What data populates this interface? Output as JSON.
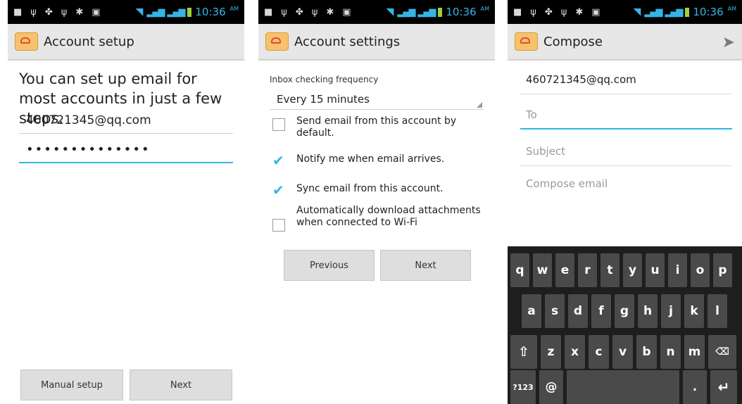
{
  "status": {
    "time": "10:36",
    "ampm": "AM",
    "icons": [
      "notification-icon",
      "usb-icon",
      "usb-debug-icon",
      "usb-icon",
      "bluetooth-icon",
      "gallery-icon"
    ]
  },
  "screen1": {
    "title": "Account setup",
    "heading": "You can set up email for most accounts in just a few steps.",
    "email_value": "460721345@qq.com",
    "password_value": "••••••••••••••",
    "buttons": {
      "manual": "Manual setup",
      "next": "Next"
    }
  },
  "screen2": {
    "title": "Account settings",
    "frequency_label": "Inbox checking frequency",
    "frequency_value": "Every 15 minutes",
    "options": [
      {
        "label": "Send email from this account by default.",
        "checked": false
      },
      {
        "label": "Notify me when email arrives.",
        "checked": true
      },
      {
        "label": "Sync email from this account.",
        "checked": true
      },
      {
        "label": "Automatically download attachments when connected to Wi-Fi",
        "checked": false
      }
    ],
    "buttons": {
      "previous": "Previous",
      "next": "Next"
    }
  },
  "screen3": {
    "title": "Compose",
    "from_value": "460721345@qq.com",
    "to_placeholder": "To",
    "subject_placeholder": "Subject",
    "body_placeholder": "Compose email",
    "keyboard": {
      "row1": [
        "q",
        "w",
        "e",
        "r",
        "t",
        "y",
        "u",
        "i",
        "o",
        "p"
      ],
      "row2": [
        "a",
        "s",
        "d",
        "f",
        "g",
        "h",
        "j",
        "k",
        "l"
      ],
      "row3": [
        "z",
        "x",
        "c",
        "v",
        "b",
        "n",
        "m"
      ],
      "sym": "?123",
      "at": "@",
      "dot": "."
    }
  },
  "colors": {
    "accent": "#33b5e5",
    "statusbar": "#000000",
    "actionbar": "#e7e7e7"
  }
}
